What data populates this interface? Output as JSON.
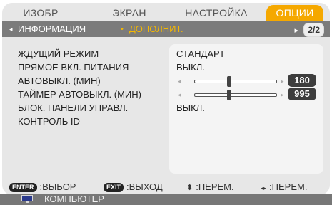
{
  "tabs": [
    {
      "label": "ИЗОБР",
      "active": false
    },
    {
      "label": "ЭКРАН",
      "active": false
    },
    {
      "label": "НАСТРОЙКА",
      "active": false
    },
    {
      "label": "ОПЦИИ",
      "active": true
    }
  ],
  "subtabs": {
    "info": {
      "glyph": "◂",
      "label": "ИНФОРМАЦИЯ"
    },
    "advanced": {
      "glyph": "•",
      "label": "ДОПОЛНИТ."
    },
    "pager": {
      "glyph": "▸",
      "label": "2/2"
    }
  },
  "settings": {
    "standby": {
      "label": "ЖДУЩИЙ РЕЖИМ",
      "value": "СТАНДАРТ"
    },
    "direct_power_on": {
      "label": "ПРЯМОЕ ВКЛ. ПИТАНИЯ",
      "value": "ВЫКЛ."
    },
    "auto_power_off": {
      "label": "АВТОВЫКЛ. (МИН)",
      "value": "180",
      "level": 0.42
    },
    "sleep_timer": {
      "label": "ТАЙМЕР АВТОВЫКЛ. (МИН)",
      "value": "995",
      "level": 0.42
    },
    "keypad_lock": {
      "label": "БЛОК. ПАНЕЛИ УПРАВЛ.",
      "value": "ВЫКЛ."
    },
    "control_id": {
      "label": "КОНТРОЛЬ ID"
    }
  },
  "footer": {
    "enter": {
      "key": "ENTER",
      "label": ":ВЫБОР"
    },
    "exit": {
      "key": "EXIT",
      "label": ":ВЫХОД"
    },
    "move_vertical": {
      "glyph": "⬍",
      "label": ":ПЕРЕМ."
    },
    "move_horizontal": {
      "glyph": "◂▸",
      "label": ":ПЕРЕМ."
    }
  },
  "status": {
    "source": "КОМПЬЮТЕР",
    "source_icon": "monitor-icon"
  },
  "colors": {
    "accent": "#f5a800",
    "panel": "#e7e7e7",
    "subbar": "#7b7b7b"
  }
}
